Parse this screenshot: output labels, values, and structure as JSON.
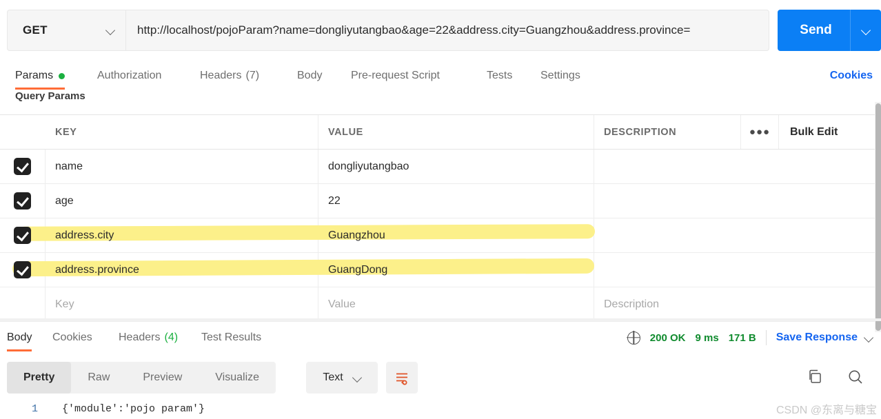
{
  "request_bar": {
    "method": "GET",
    "method_dropdown_icon": "chevron-down-icon",
    "url": "http://localhost/pojoParam?name=dongliyutangbao&age=22&address.city=Guangzhou&address.province=",
    "send_label": "Send",
    "send_dropdown_icon": "chevron-down-icon"
  },
  "request_tabs": {
    "items": [
      {
        "label": "Params",
        "active": true,
        "dot": true
      },
      {
        "label": "Authorization",
        "active": false
      },
      {
        "label": "Headers",
        "count": "(7)",
        "active": false
      },
      {
        "label": "Body",
        "active": false
      },
      {
        "label": "Pre-request Script",
        "active": false
      },
      {
        "label": "Tests",
        "active": false
      },
      {
        "label": "Settings",
        "active": false
      }
    ],
    "cookies_label": "Cookies"
  },
  "query_params": {
    "section_title": "Query Params",
    "columns": {
      "key": "KEY",
      "value": "VALUE",
      "description": "DESCRIPTION",
      "more_icon": "ellipsis-icon",
      "bulk_edit": "Bulk Edit"
    },
    "rows": [
      {
        "checked": true,
        "key": "name",
        "value": "dongliyutangbao",
        "description": "",
        "highlighted": false
      },
      {
        "checked": true,
        "key": "age",
        "value": "22",
        "description": "",
        "highlighted": false
      },
      {
        "checked": true,
        "key": "address.city",
        "value": "Guangzhou",
        "description": "",
        "highlighted": true
      },
      {
        "checked": true,
        "key": "address.province",
        "value": "GuangDong",
        "description": "",
        "highlighted": true
      }
    ],
    "new_row_placeholders": {
      "key": "Key",
      "value": "Value",
      "description": "Description"
    }
  },
  "response": {
    "tabs": [
      {
        "label": "Body",
        "active": true
      },
      {
        "label": "Cookies",
        "active": false
      },
      {
        "label": "Headers",
        "count": "(4)",
        "active": false
      },
      {
        "label": "Test Results",
        "active": false
      }
    ],
    "status_icon": "globe-icon",
    "status": "200 OK",
    "time": "9 ms",
    "size": "171 B",
    "save_response": "Save Response",
    "save_response_icon": "chevron-down-icon",
    "view_modes": [
      {
        "label": "Pretty",
        "active": true
      },
      {
        "label": "Raw",
        "active": false
      },
      {
        "label": "Preview",
        "active": false
      },
      {
        "label": "Visualize",
        "active": false
      }
    ],
    "format": "Text",
    "format_icon": "chevron-down-icon",
    "wrap_icon": "wrap-lines-icon",
    "copy_icon": "copy-icon",
    "search_icon": "search-icon",
    "body_lines": [
      {
        "number": "1",
        "text": "{'module':'pojo param'}"
      }
    ]
  },
  "watermark": "CSDN @东离与糖宝",
  "colors": {
    "accent_orange": "#ff6c37",
    "send_blue": "#0b7ff5",
    "link_blue": "#1565f0",
    "status_green": "#108b2e",
    "dot_green": "#1bb040",
    "highlight_yellow": "#fcf08a"
  }
}
